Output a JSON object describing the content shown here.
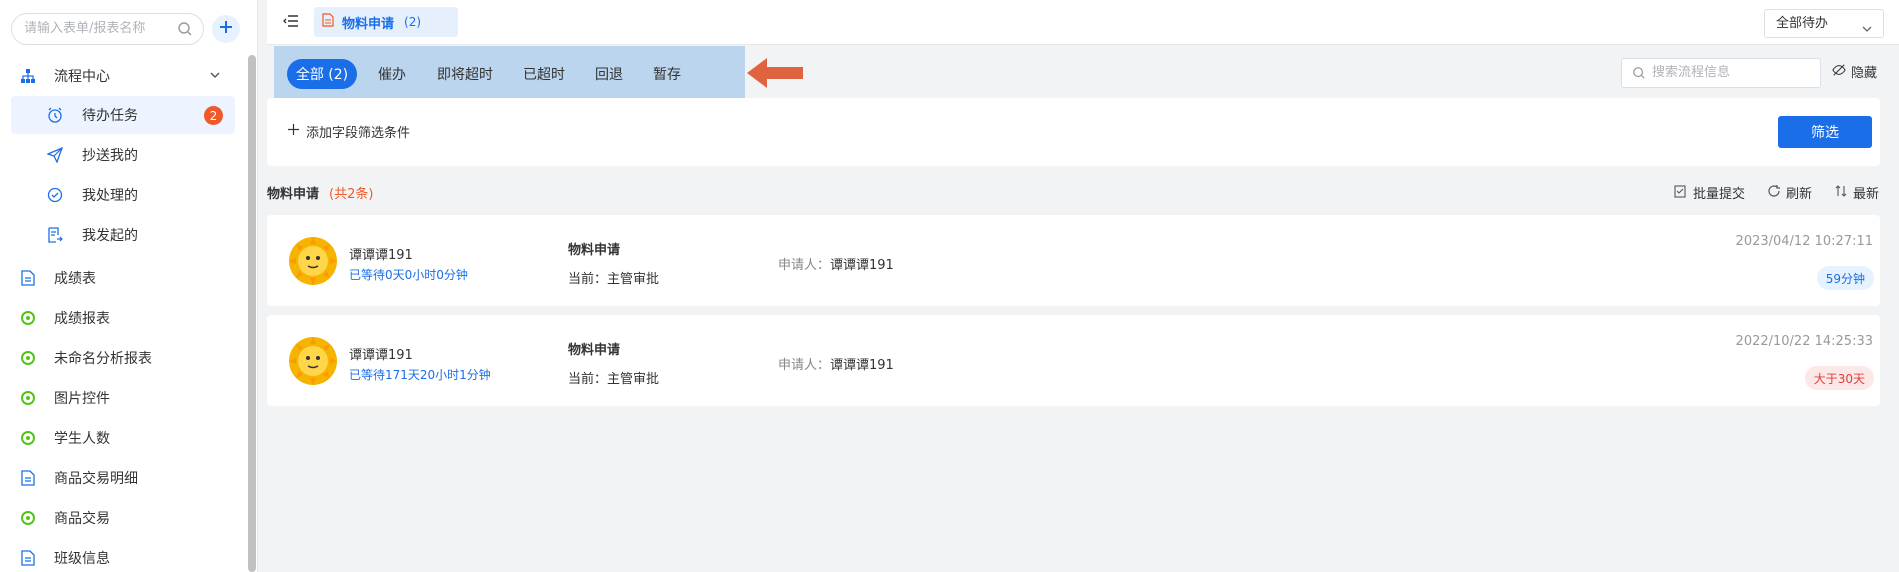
{
  "sidebar": {
    "search_placeholder": "请输入表单/报表名称",
    "flow_center": {
      "label": "流程中心"
    },
    "sub_items": [
      {
        "label": "待办任务",
        "icon": "clock-icon",
        "badge": "2",
        "active": true
      },
      {
        "label": "抄送我的",
        "icon": "paper-plane-icon"
      },
      {
        "label": "我处理的",
        "icon": "check-circle-icon"
      },
      {
        "label": "我发起的",
        "icon": "document-arrow-icon"
      }
    ],
    "items": [
      {
        "label": "成绩表",
        "icon": "document-icon"
      },
      {
        "label": "成绩报表",
        "icon": "report-icon"
      },
      {
        "label": "未命名分析报表",
        "icon": "report-icon"
      },
      {
        "label": "图片控件",
        "icon": "report-icon"
      },
      {
        "label": "学生人数",
        "icon": "report-icon"
      },
      {
        "label": "商品交易明细",
        "icon": "document-icon"
      },
      {
        "label": "商品交易",
        "icon": "report-icon"
      },
      {
        "label": "班级信息",
        "icon": "document-icon"
      }
    ]
  },
  "topbar": {
    "tab_label": "物料申请",
    "tab_count": "(2)",
    "select_value": "全部待办"
  },
  "filter_tabs": [
    {
      "label": "全部 (2)",
      "active": true
    },
    {
      "label": "催办"
    },
    {
      "label": "即将超时"
    },
    {
      "label": "已超时"
    },
    {
      "label": "回退"
    },
    {
      "label": "暂存"
    }
  ],
  "toolbar": {
    "search_placeholder": "搜索流程信息",
    "hide_label": "隐藏",
    "add_condition": "添加字段筛选条件",
    "filter_button": "筛选"
  },
  "list": {
    "title": "物料申请",
    "total": "(共2条)",
    "actions": {
      "batch": "批量提交",
      "refresh": "刷新",
      "latest": "最新"
    },
    "rows": [
      {
        "name": "谭谭谭191",
        "wait": "已等待0天0小时0分钟",
        "form": "物料申请",
        "stage": "当前：主管审批",
        "applicant_label": "申请人：",
        "applicant": "谭谭谭191",
        "time": "2023/04/12 10:27:11",
        "badge": "59分钟",
        "badge_type": "blue"
      },
      {
        "name": "谭谭谭191",
        "wait": "已等待171天20小时1分钟",
        "form": "物料申请",
        "stage": "当前：主管审批",
        "applicant_label": "申请人：",
        "applicant": "谭谭谭191",
        "time": "2022/10/22 14:25:33",
        "badge": "大于30天",
        "badge_type": "red"
      }
    ]
  },
  "colors": {
    "accent": "#1a6fe8",
    "badge_red": "#f05a28",
    "tab_highlight": "#bcd5ee",
    "annotation_arrow": "#e0633f"
  }
}
